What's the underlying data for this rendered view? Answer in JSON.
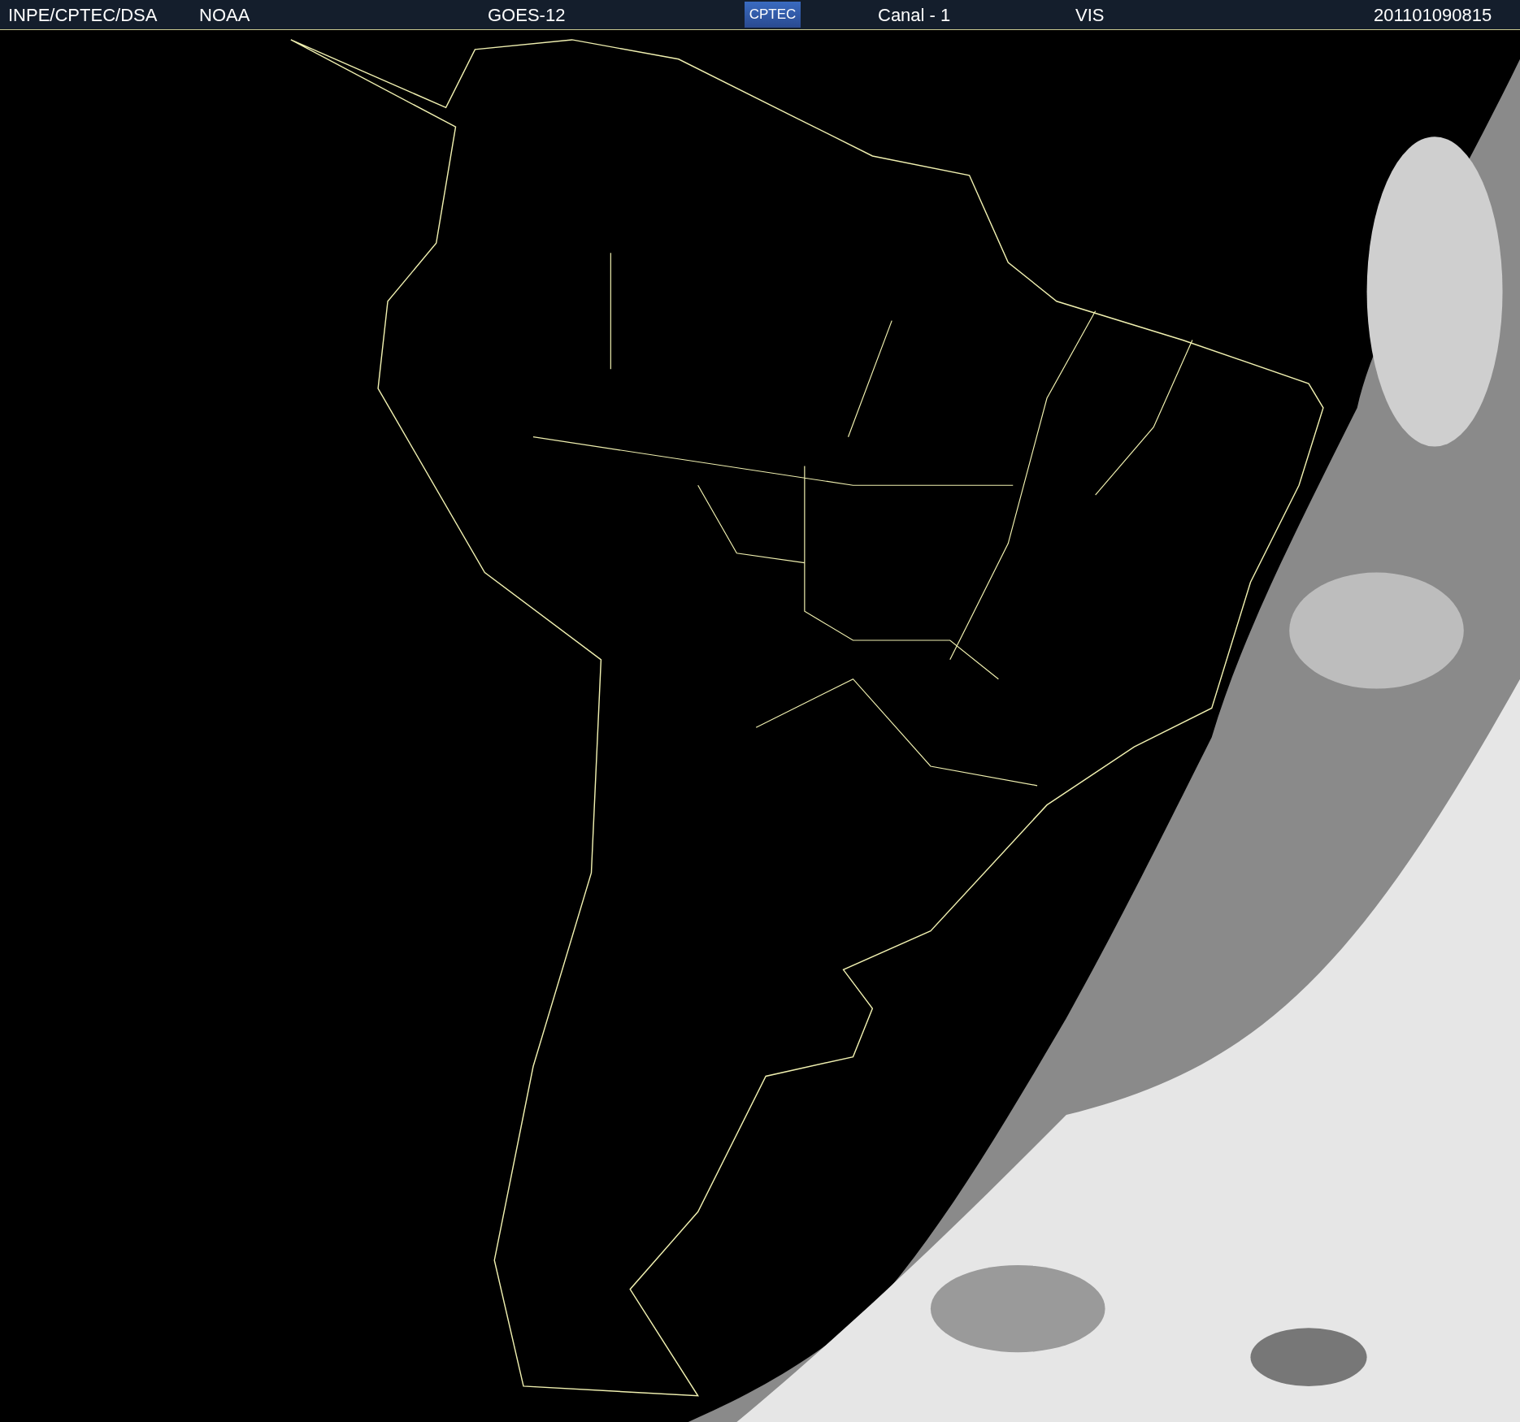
{
  "header": {
    "texts": [
      {
        "kind": "text",
        "label": "INPE/CPTEC/DSA"
      },
      {
        "kind": "text",
        "label": "NOAA"
      },
      {
        "kind": "text",
        "label": "GOES-12"
      },
      {
        "kind": "logo",
        "label": "CPTEC"
      },
      {
        "kind": "text",
        "label": "Canal - 1"
      },
      {
        "kind": "text",
        "label": "VIS"
      },
      {
        "kind": "text",
        "label": "201101090815"
      }
    ]
  }
}
